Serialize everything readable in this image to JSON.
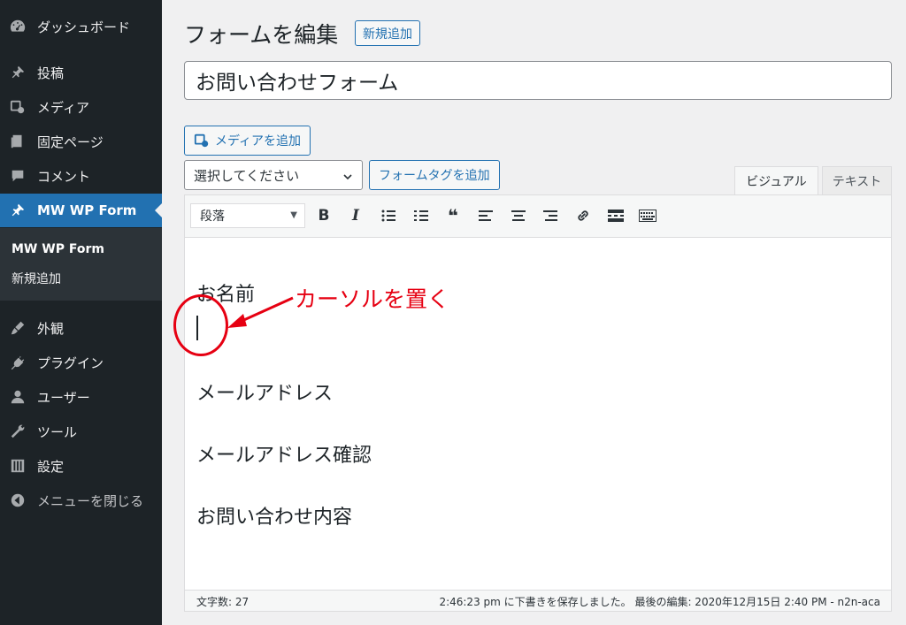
{
  "sidebar": {
    "items": [
      {
        "label": "ダッシュボード",
        "icon": "dashboard-icon"
      },
      {
        "label": "投稿",
        "icon": "pin-icon"
      },
      {
        "label": "メディア",
        "icon": "media-icon"
      },
      {
        "label": "固定ページ",
        "icon": "page-icon"
      },
      {
        "label": "コメント",
        "icon": "comment-icon"
      },
      {
        "label": "MW WP Form",
        "icon": "pin-icon"
      },
      {
        "label": "外観",
        "icon": "brush-icon"
      },
      {
        "label": "プラグイン",
        "icon": "plugin-icon"
      },
      {
        "label": "ユーザー",
        "icon": "user-icon"
      },
      {
        "label": "ツール",
        "icon": "wrench-icon"
      },
      {
        "label": "設定",
        "icon": "settings-icon"
      },
      {
        "label": "メニューを閉じる",
        "icon": "collapse-icon"
      }
    ],
    "submenu": {
      "items": [
        {
          "label": "MW WP Form"
        },
        {
          "label": "新規追加"
        }
      ]
    }
  },
  "header": {
    "title": "フォームを編集",
    "add_new_label": "新規追加"
  },
  "form": {
    "title_value": "お問い合わせフォーム"
  },
  "editor": {
    "add_media_label": "メディアを追加",
    "select_value": "選択してください",
    "add_form_tag_label": "フォームタグを追加",
    "tab_visual": "ビジュアル",
    "tab_text": "テキスト",
    "format_value": "段落",
    "content": {
      "lines": [
        "お名前",
        "メールアドレス",
        "メールアドレス確認",
        "お問い合わせ内容"
      ]
    },
    "annotation": "カーソルを置く",
    "annotation_color": "#e60012",
    "status": {
      "word_count": "文字数: 27",
      "autosave": "2:46:23 pm に下書きを保存しました。 最後の編集: 2020年12月15日 2:40 PM - n2n-aca"
    }
  },
  "colors": {
    "sidebar_bg": "#1d2327",
    "accent": "#2271b1"
  }
}
